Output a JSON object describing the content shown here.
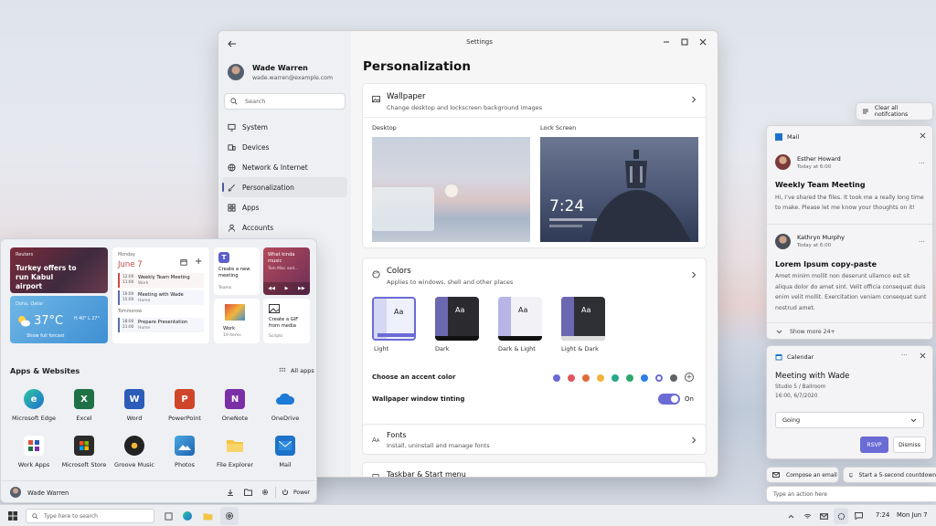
{
  "settings": {
    "title": "Settings",
    "user": {
      "name": "Wade Warren",
      "email": "wade.warren@example.com"
    },
    "search_placeholder": "Search",
    "nav": [
      "System",
      "Devices",
      "Network & Internet",
      "Personalization",
      "Apps",
      "Accounts"
    ],
    "page_title": "Personalization",
    "wallpaper": {
      "title": "Wallpaper",
      "sub": "Change desktop and lockscreen background images",
      "desktop_label": "Desktop",
      "lock_label": "Lock Screen",
      "lock_time": "7:24"
    },
    "colors": {
      "title": "Colors",
      "sub": "Applies to windows, shell and other places",
      "themes": [
        "Light",
        "Dark",
        "Dark & Light",
        "Light & Dark"
      ],
      "accent_label": "Choose an accent color",
      "accent_colors": [
        "#6b6bd6",
        "#e0575b",
        "#e06b38",
        "#f0b43c",
        "#27a88a",
        "#2ca86a",
        "#2d7fe0",
        "#6b6bd6",
        "#5f6469"
      ],
      "tinting_label": "Wallpaper window tinting",
      "tinting_state": "On"
    },
    "fonts": {
      "title": "Fonts",
      "sub": "Install, uninstall and manage fonts"
    },
    "taskbar": {
      "title": "Taskbar & Start menu"
    }
  },
  "start": {
    "news": {
      "source": "Reuters",
      "headline": "Turkey offers to run Kabul airport"
    },
    "weather": {
      "place": "Doha, Qatar",
      "temp": "37°C",
      "hilo": "H 40° L 27°",
      "link": "Show full forcast"
    },
    "calendar": {
      "day": "Monday",
      "date": "June 7",
      "events": [
        {
          "time": "12:00\n11:00",
          "title": "Weekly Team Meeting",
          "sub": "Work"
        },
        {
          "time": "16:00\n15:00",
          "title": "Meeting with Wade",
          "sub": "Home"
        }
      ],
      "tomorrow": "Tommorow",
      "tomorrow_events": [
        {
          "time": "18:00\n21:00",
          "title": "Prepare Presentation",
          "sub": "Home"
        }
      ]
    },
    "teams": {
      "title": "Create a new meeting",
      "sub": "Teams"
    },
    "music": {
      "title": "What kinda music",
      "sub": "Tom Misc and..."
    },
    "work": {
      "title": "Work",
      "sub": "19 items"
    },
    "gif": {
      "title": "Create a GIF from media",
      "sub": "Scripts"
    },
    "section_title": "Apps & Websites",
    "all_apps": "All apps",
    "apps": [
      "Microsoft Edge",
      "Excel",
      "Word",
      "PowerPoint",
      "OneNote",
      "OneDrive",
      "Work Apps",
      "Microsoft Store",
      "Groove Music",
      "Photos",
      "File Explorer",
      "Mail"
    ],
    "user": "Wade Warren",
    "power": "Power"
  },
  "notifications": {
    "clear_all": "Clear all notifcations",
    "mail": {
      "app": "Mail",
      "items": [
        {
          "sender": "Esther Howard",
          "time": "Today at 6:00",
          "subject": "Weekly Team Meeting",
          "body": "Hi, I've shared the files. It took me a really long time to make. Please let me know your thoughts on it!"
        },
        {
          "sender": "Kathryn Murphy",
          "time": "Today at 6:00",
          "subject": "Lorem Ipsum copy-paste",
          "body": "Amet minim mollit non deserunt ullamco est sit aliqua dolor do amet sint. Velit officia consequat duis enim velit mollit. Exercitation veniam consequat sunt nostrud amet."
        }
      ],
      "more": "Show more 24+"
    },
    "calendar": {
      "app": "Calendar",
      "title": "Meeting with Wade",
      "location": "Studio 5 / Ballroom",
      "time": "16:00, 6/7/2020",
      "select": "Going",
      "rsvp": "RSVP",
      "dismiss": "Dismiss"
    },
    "actions": {
      "compose": "Compose an email",
      "countdown": "Start a 5-second countdown",
      "input_placeholder": "Type an action here"
    }
  },
  "taskbar": {
    "search_placeholder": "Type here to search",
    "time": "7:24",
    "date": "Mon Jun 7"
  }
}
